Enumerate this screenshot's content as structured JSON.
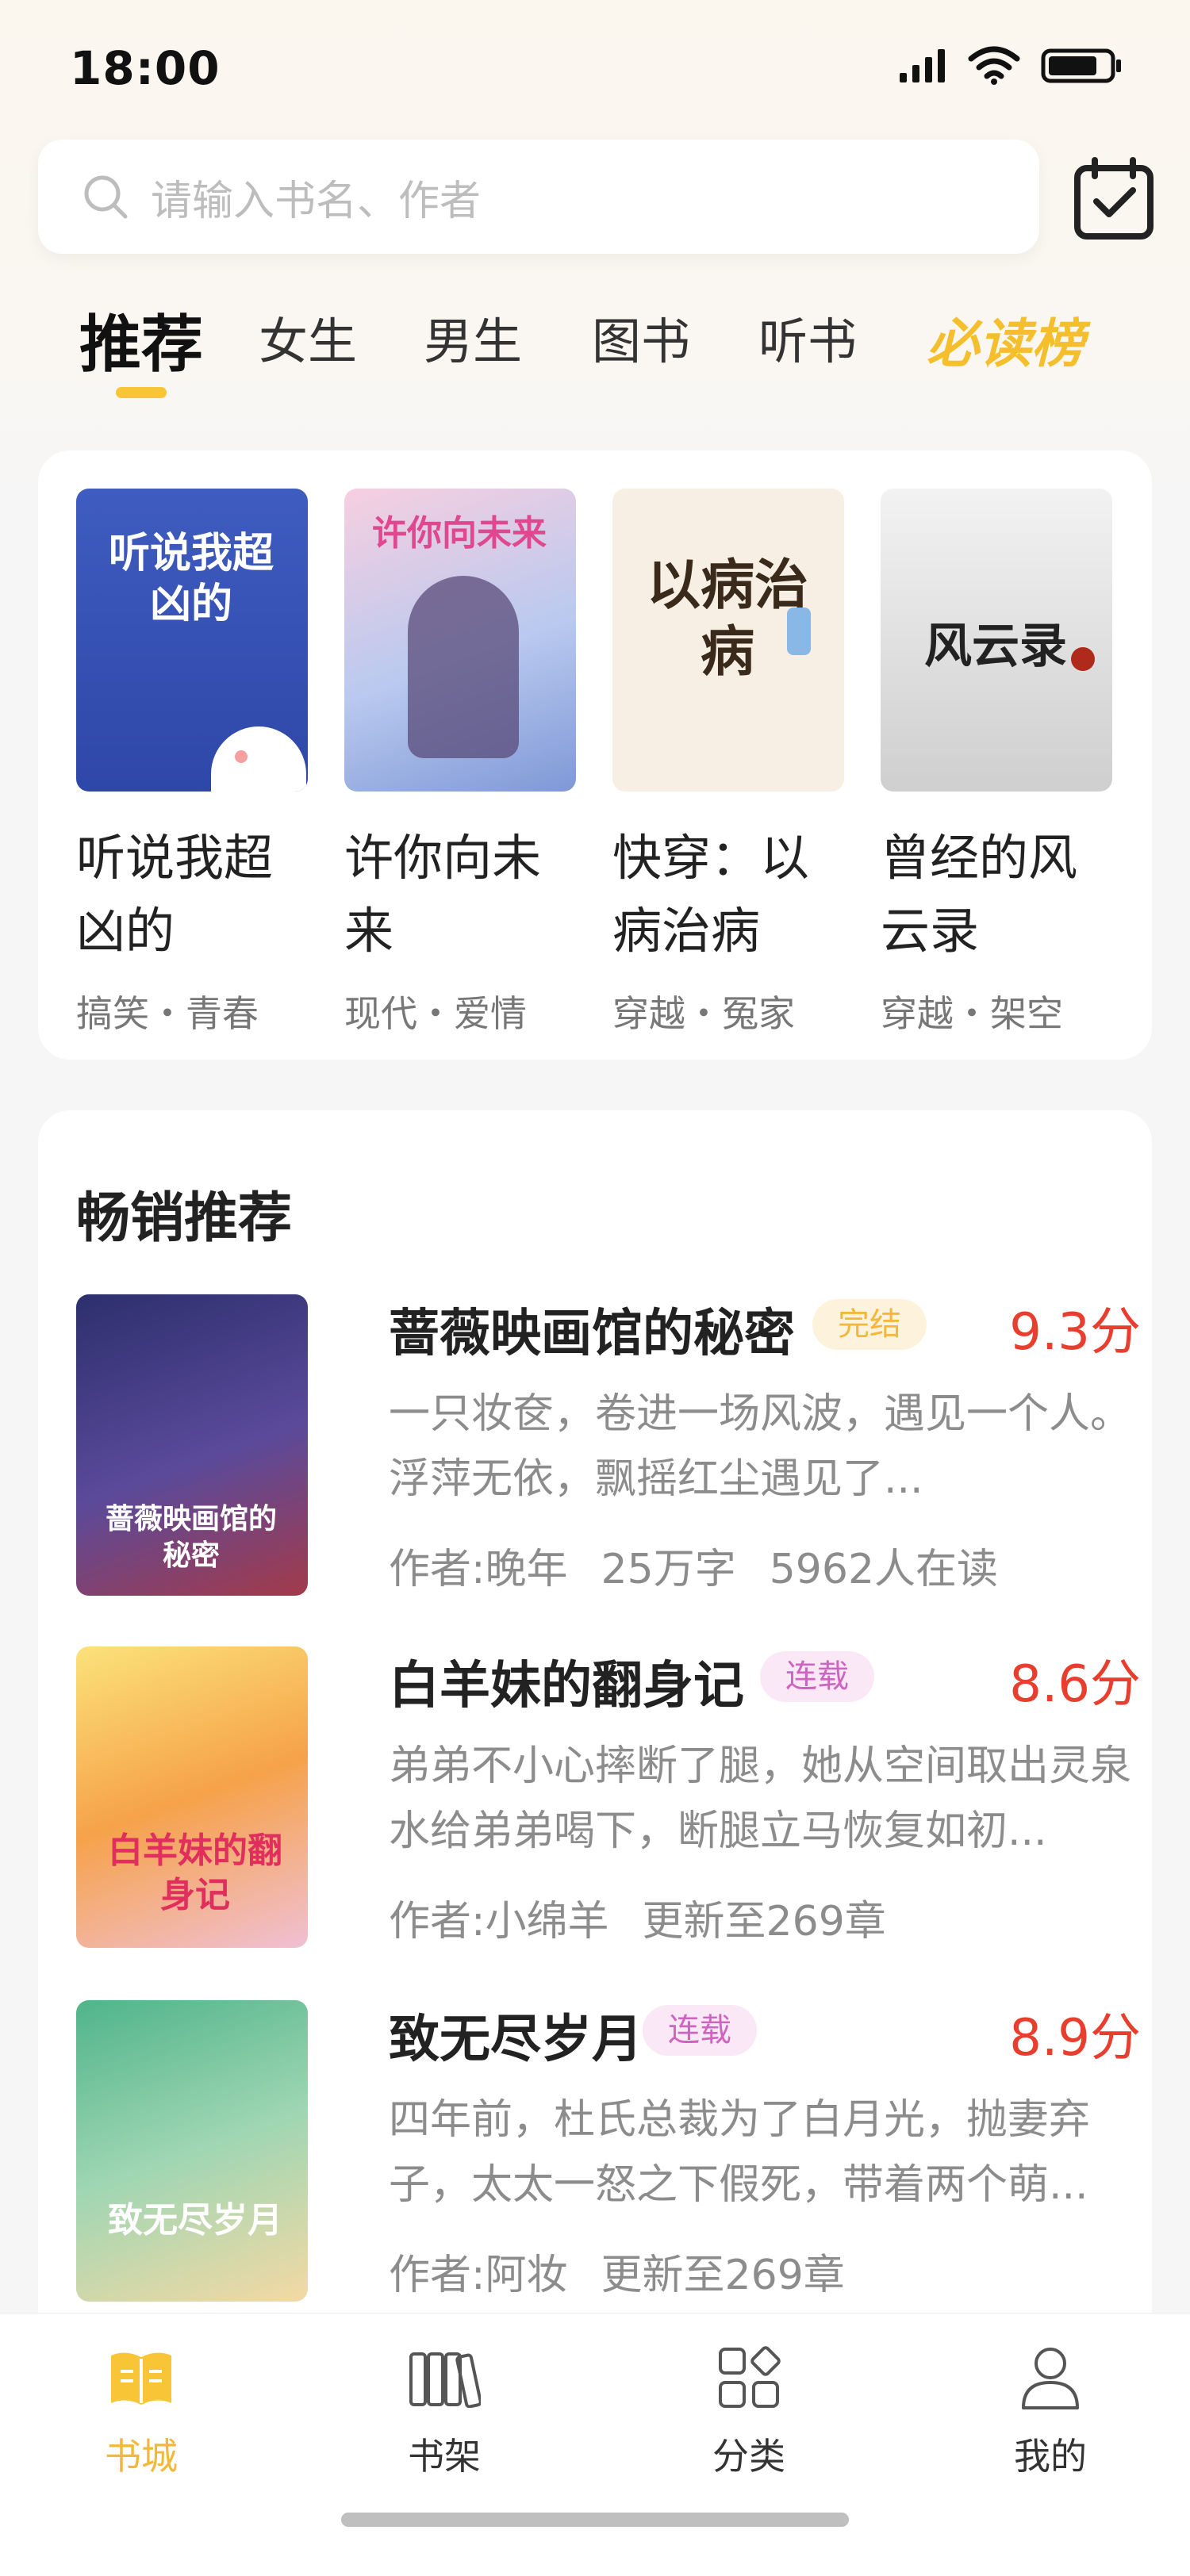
{
  "status_bar": {
    "time": "18:00"
  },
  "search": {
    "placeholder": "请输入书名、作者"
  },
  "tabs": [
    {
      "label": "推荐"
    },
    {
      "label": "女生"
    },
    {
      "label": "男生"
    },
    {
      "label": "图书"
    },
    {
      "label": "听书"
    },
    {
      "label": "必读榜"
    }
  ],
  "featured": [
    {
      "title": "听说我超凶的",
      "tags": "搞笑・青春",
      "cover_text": "听说我超凶的"
    },
    {
      "title": "许你向未来",
      "tags": "现代・爱情",
      "cover_text": "许你向未来"
    },
    {
      "title": "快穿：以病治病",
      "tags": "穿越・冤家",
      "cover_text": "以病治病"
    },
    {
      "title": "曾经的风云录",
      "tags": "穿越・架空",
      "cover_text": "风云录"
    }
  ],
  "bestsellers": {
    "title": "畅销推荐",
    "books": [
      {
        "title": "蔷薇映画馆的秘密",
        "badge": "完结",
        "score": "9.3分",
        "desc": "一只妆奁，卷进一场风波，遇见一个人。浮萍无依，飘摇红尘遇见了...",
        "author": "作者:晚年",
        "extra1": "25万字",
        "extra2": "5962人在读",
        "cover_text": "蔷薇映画馆的秘密"
      },
      {
        "title": "白羊妹的翻身记",
        "badge": "连载",
        "score": "8.6分",
        "desc": "弟弟不小心摔断了腿，她从空间取出灵泉水给弟弟喝下，断腿立马恢复如初...",
        "author": "作者:小绵羊",
        "extra1": "更新至269章",
        "extra2": "",
        "cover_text": "白羊妹的翻身记"
      },
      {
        "title": "致无尽岁月",
        "badge": "连载",
        "score": "8.9分",
        "desc": "四年前，杜氏总裁为了白月光，抛妻弃子，太太一怒之下假死，带着两个萌...",
        "author": "作者:阿妆",
        "extra1": "更新至269章",
        "extra2": "",
        "cover_text": "致无尽岁月"
      }
    ]
  },
  "bottom_nav": [
    {
      "label": "书城",
      "icon": "book-open-icon"
    },
    {
      "label": "书架",
      "icon": "bookshelf-icon"
    },
    {
      "label": "分类",
      "icon": "category-grid-icon"
    },
    {
      "label": "我的",
      "icon": "user-icon"
    }
  ],
  "colors": {
    "accent": "#f8c537",
    "score": "#e83e2e",
    "badge_done": "#f3b83b",
    "badge_serial": "#cf63c0"
  }
}
